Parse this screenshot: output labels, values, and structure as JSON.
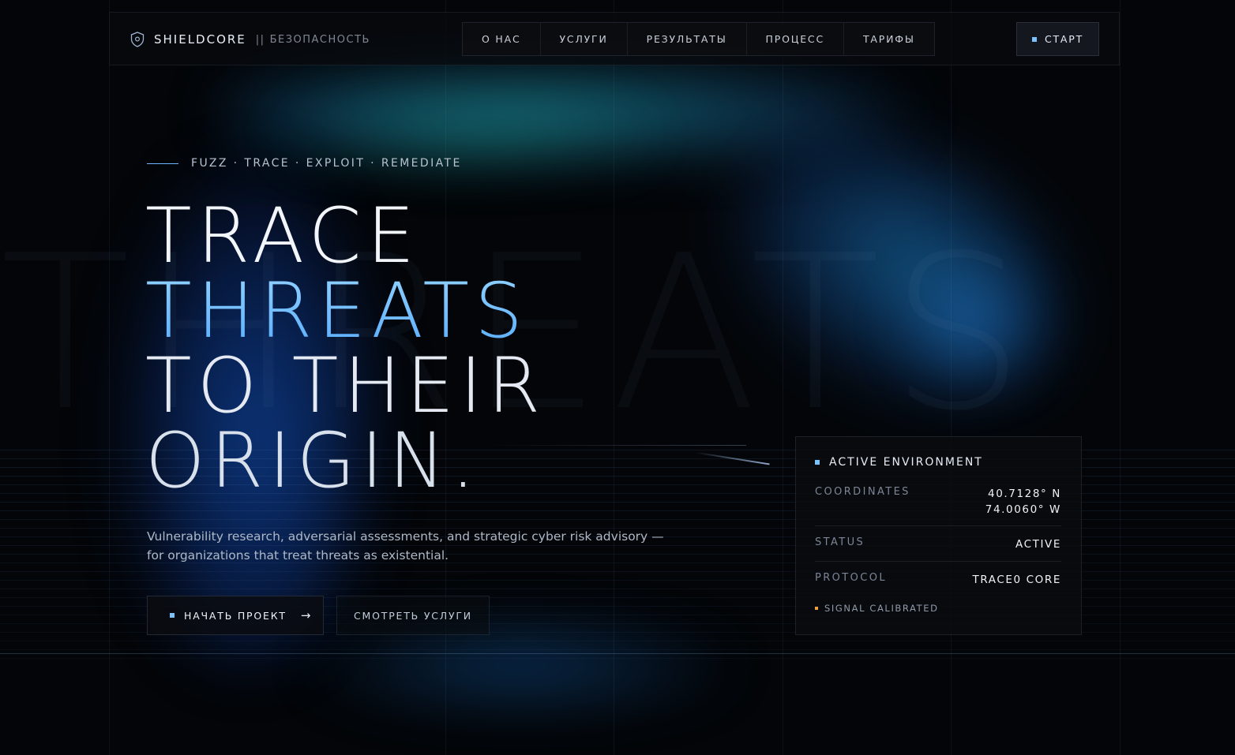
{
  "brand": {
    "name": "SHIELDCORE",
    "separator": "||",
    "subtitle": "БЕЗОПАСНОСТЬ",
    "icon": "shield-icon"
  },
  "nav": {
    "items": [
      {
        "label": "О НАС"
      },
      {
        "label": "УСЛУГИ"
      },
      {
        "label": "РЕЗУЛЬТАТЫ"
      },
      {
        "label": "ПРОЦЕСС"
      },
      {
        "label": "ТАРИФЫ"
      }
    ],
    "start_label": "СТАРТ"
  },
  "hero": {
    "background_word": "THREATS",
    "eyebrow": "FUZZ · TRACE · EXPLOIT · REMEDIATE",
    "headline": [
      "TRACE",
      "THREATS",
      "TO THEIR",
      "ORIGIN."
    ],
    "description": "Vulnerability research, adversarial assessments, and strategic cyber risk advisory — for organizations that treat threats as existential.",
    "primary_button": "НАЧАТЬ ПРОЕКТ",
    "primary_button_icon": "arrow-right-icon",
    "secondary_button": "СМОТРЕТЬ УСЛУГИ"
  },
  "environment_panel": {
    "title": "ACTIVE ENVIRONMENT",
    "rows": [
      {
        "label": "COORDINATES",
        "value_line1": "40.7128° N",
        "value_line2": "74.0060° W"
      },
      {
        "label": "STATUS",
        "value": "ACTIVE"
      },
      {
        "label": "PROTOCOL",
        "value": "TRACE0 CORE"
      }
    ],
    "signal": "SIGNAL CALIBRATED"
  },
  "colors": {
    "accent": "#6fb4ff",
    "background": "#030508",
    "signal_dot": "#f0a13c"
  }
}
